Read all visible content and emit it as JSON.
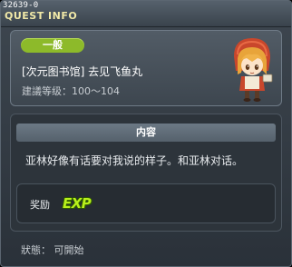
{
  "window": {
    "id_label": "32639-0",
    "title": "QUEST INFO"
  },
  "quest": {
    "category": "一般",
    "name": "[次元图书馆] 去见飞鱼丸",
    "level_label": "建議等级：100～104"
  },
  "content": {
    "header": "内容",
    "text": "亚林好像有话要对我说的样子。和亚林对话。"
  },
  "reward": {
    "label": "奖励",
    "exp_label": "EXP"
  },
  "status": {
    "text": "狀態： 可開始"
  },
  "colors": {
    "title": "#f1e9a8",
    "badge": "#8dba2a",
    "exp": "#b8f01c"
  },
  "icons": {
    "npc": "npc-portrait-icon",
    "exp": "exp-icon"
  }
}
